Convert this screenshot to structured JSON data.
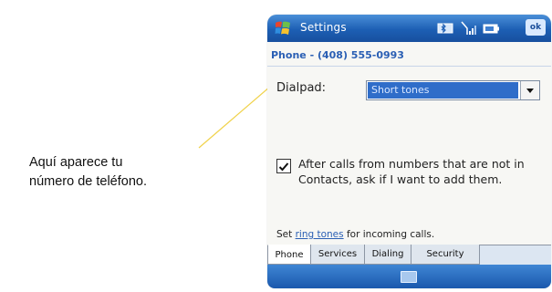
{
  "callout": {
    "line1": "Aquí aparece tu",
    "line2": "número de teléfono."
  },
  "window": {
    "title": "Settings",
    "ok_label": "ok",
    "status_icons": [
      "bluetooth-icon",
      "signal-icon",
      "battery-icon"
    ]
  },
  "phone_page": {
    "subtitle": "Phone - (408) 555-0993",
    "dialpad_label": "Dialpad:",
    "dialpad_value": "Short tones",
    "checkbox_checked": true,
    "checkbox_text": "After calls from numbers that are not in Contacts, ask if I want to add them.",
    "ring_prefix": "Set",
    "ring_link": "ring tones",
    "ring_suffix": "for incoming calls."
  },
  "tabs": [
    {
      "label": "Phone",
      "active": true
    },
    {
      "label": "Services",
      "active": false
    },
    {
      "label": "Dialing",
      "active": false
    },
    {
      "label": "Security",
      "active": false
    }
  ],
  "menubar": {
    "icon": "keyboard-icon"
  },
  "colors": {
    "titlebar": "#1d5fb4",
    "accent": "#2a5fb4",
    "selection": "#2f6dc9"
  }
}
